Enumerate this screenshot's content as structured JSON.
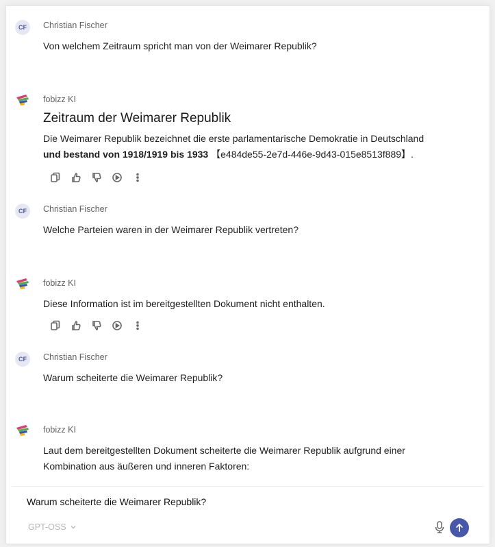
{
  "messages": [
    {
      "type": "user",
      "initials": "CF",
      "author": "Christian Fischer",
      "text": "Von welchem Zeitraum spricht man von der Weimarer Republik?"
    },
    {
      "type": "ai",
      "author": "fobizz KI",
      "title": "Zeitraum der Weimarer Republik",
      "text_line1": "Die Weimarer Republik bezeichnet die erste parlamentarische Demokratie in Deutschland",
      "text_line2_bold": "und bestand von 1918/1919 bis 1933",
      "text_line2_ref": "【e484de55-2e7d-446e-9d43-015e8513f889】."
    },
    {
      "type": "user",
      "initials": "CF",
      "author": "Christian Fischer",
      "text": "Welche Parteien waren in der Weimarer Republik vertreten?"
    },
    {
      "type": "ai",
      "author": "fobizz KI",
      "text": "Diese Information ist im bereitgestellten Dokument nicht enthalten."
    },
    {
      "type": "user",
      "initials": "CF",
      "author": "Christian Fischer",
      "text": "Warum scheiterte die Weimarer Republik?"
    },
    {
      "type": "ai",
      "author": "fobizz KI",
      "text": "Laut dem bereitgestellten Dokument scheiterte die Weimarer Republik aufgrund einer Kombination aus äußeren und inneren Faktoren:"
    }
  ],
  "action_icons": [
    "copy-icon",
    "thumbs-up-icon",
    "thumbs-down-icon",
    "play-icon",
    "more-icon"
  ],
  "composer": {
    "value": "Warum scheiterte die Weimarer Republik?",
    "model": "GPT-OSS",
    "mic_icon": "microphone-icon",
    "send_icon": "send-arrow-icon",
    "accent": "#4758a8"
  }
}
